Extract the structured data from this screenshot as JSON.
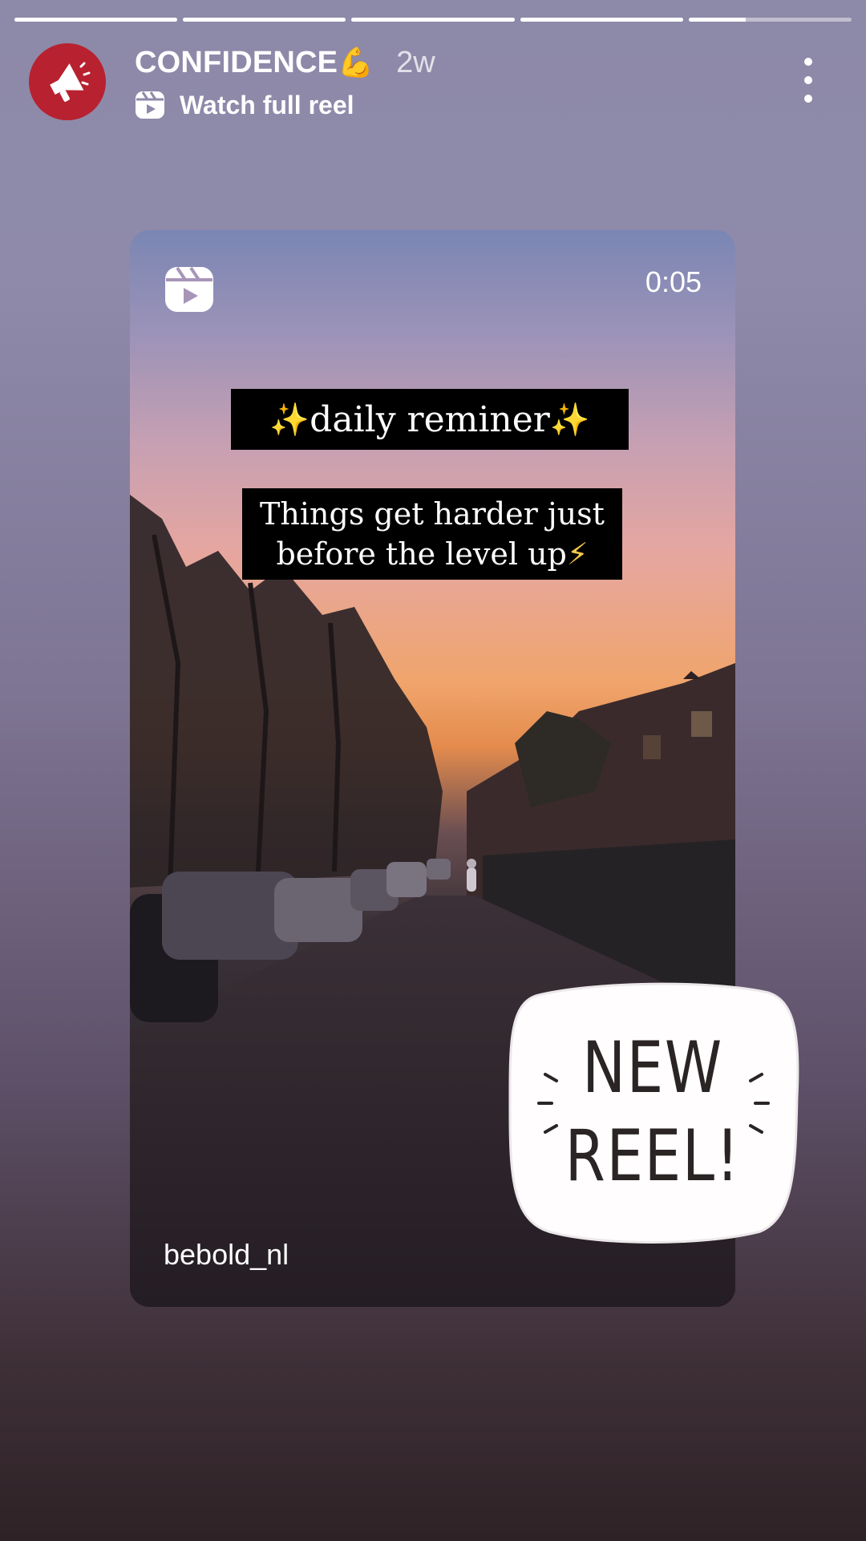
{
  "story": {
    "progress_segments": [
      1,
      1,
      1,
      1,
      0.35
    ]
  },
  "header": {
    "username": "CONFIDENCE",
    "username_emoji": "💪",
    "time_ago": "2w",
    "subtitle": "Watch full reel",
    "avatar_icon": "megaphone-icon",
    "subtitle_icon": "reels-icon",
    "more_icon": "more-vertical-icon"
  },
  "reel": {
    "duration": "0:05",
    "caption_title": "daily reminer",
    "caption_title_emoji": "✨",
    "caption_line1": "Things get harder just",
    "caption_line2": "before the level up",
    "caption_emoji": "⚡",
    "credit": "bebold_nl"
  },
  "sticker": {
    "line1": "NEW",
    "line2": "REEL!"
  },
  "colors": {
    "avatar_bg": "#b8212f",
    "sparkle": "#f4c84a"
  }
}
